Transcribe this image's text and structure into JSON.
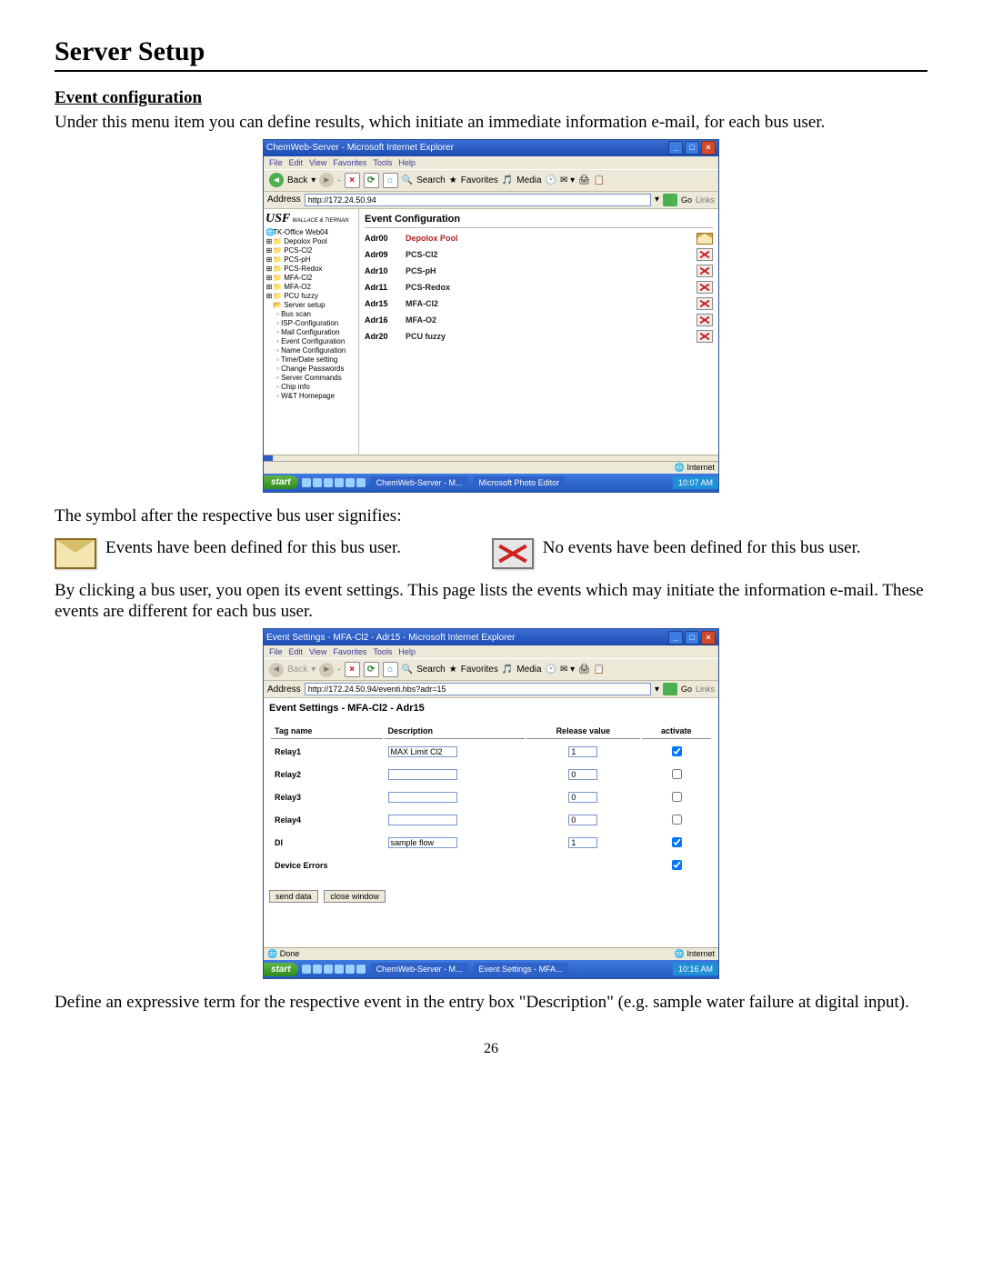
{
  "page_title": "Server Setup",
  "section_head": "Event configuration",
  "intro": "Under this menu item you can define results, which initiate an immediate information e-mail, for each bus user.",
  "legend_intro": "The symbol after the respective bus user signifies:",
  "legend_defined": "Events have been defined for this bus user.",
  "legend_none": "No events have been defined for this bus user.",
  "click_text": "By clicking a bus user, you open its event settings. This page lists the events which may initiate the information e-mail. These events are different for each bus user.",
  "outro": "Define an expressive term for the respective event in the entry box \"Description\" (e.g. sample water failure at digital input).",
  "page_number": "26",
  "shot1": {
    "title": "ChemWeb-Server - Microsoft Internet Explorer",
    "menus": [
      "File",
      "Edit",
      "View",
      "Favorites",
      "Tools",
      "Help"
    ],
    "back": "Back",
    "search": "Search",
    "favorites": "Favorites",
    "media": "Media",
    "address_label": "Address",
    "address": "http://172.24.50.94",
    "go": "Go",
    "links": "Links",
    "logo": "USF",
    "logo_sub": "WALLACE & TIERNAN",
    "tree_root": "TK-Office Web04",
    "tree_top": [
      "Depolox Pool",
      "PCS-Cl2",
      "PCS-pH",
      "PCS-Redox",
      "MFA-Cl2",
      "MFA-O2",
      "PCU fuzzy"
    ],
    "tree_server": "Server setup",
    "tree_server_items": [
      "Bus scan",
      "ISP-Configuration",
      "Mail Configuration",
      "Event Configuration",
      "Name Configuration",
      "Time/Date setting",
      "Change Passwords",
      "Server Commands",
      "Chip info",
      "W&T Homepage"
    ],
    "panel_title": "Event Configuration",
    "rows": [
      {
        "adr": "Adr00",
        "name": "Depolox Pool",
        "defined": true
      },
      {
        "adr": "Adr09",
        "name": "PCS-Cl2",
        "defined": false
      },
      {
        "adr": "Adr10",
        "name": "PCS-pH",
        "defined": false
      },
      {
        "adr": "Adr11",
        "name": "PCS-Redox",
        "defined": false
      },
      {
        "adr": "Adr15",
        "name": "MFA-Cl2",
        "defined": false
      },
      {
        "adr": "Adr16",
        "name": "MFA-O2",
        "defined": false
      },
      {
        "adr": "Adr20",
        "name": "PCU fuzzy",
        "defined": false
      }
    ],
    "status_right": "Internet",
    "start": "start",
    "task1": "ChemWeb-Server - M...",
    "task2": "Microsoft Photo Editor",
    "clock": "10:07 AM"
  },
  "shot2": {
    "title": "Event Settings - MFA-Cl2 - Adr15 - Microsoft Internet Explorer",
    "menus": [
      "File",
      "Edit",
      "View",
      "Favorites",
      "Tools",
      "Help"
    ],
    "back": "Back",
    "search": "Search",
    "favorites": "Favorites",
    "media": "Media",
    "address_label": "Address",
    "address": "http://172.24.50.94/eventi.hbs?adr=15",
    "go": "Go",
    "links": "Links",
    "panel_title": "Event Settings - MFA-Cl2 - Adr15",
    "th_tag": "Tag name",
    "th_desc": "Description",
    "th_rel": "Release value",
    "th_act": "activate",
    "rows": [
      {
        "tag": "Relay1",
        "desc": "MAX Limit Cl2",
        "rel": "1",
        "act": true
      },
      {
        "tag": "Relay2",
        "desc": "",
        "rel": "0",
        "act": false
      },
      {
        "tag": "Relay3",
        "desc": "",
        "rel": "0",
        "act": false
      },
      {
        "tag": "Relay4",
        "desc": "",
        "rel": "0",
        "act": false
      },
      {
        "tag": "DI",
        "desc": "sample flow",
        "rel": "1",
        "act": true
      },
      {
        "tag": "Device Errors",
        "desc": null,
        "rel": null,
        "act": true
      }
    ],
    "btn_send": "send data",
    "btn_close": "close window",
    "status_left": "Done",
    "status_right": "Internet",
    "start": "start",
    "task1": "ChemWeb-Server - M...",
    "task2": "Event Settings - MFA...",
    "clock": "10:16 AM"
  }
}
